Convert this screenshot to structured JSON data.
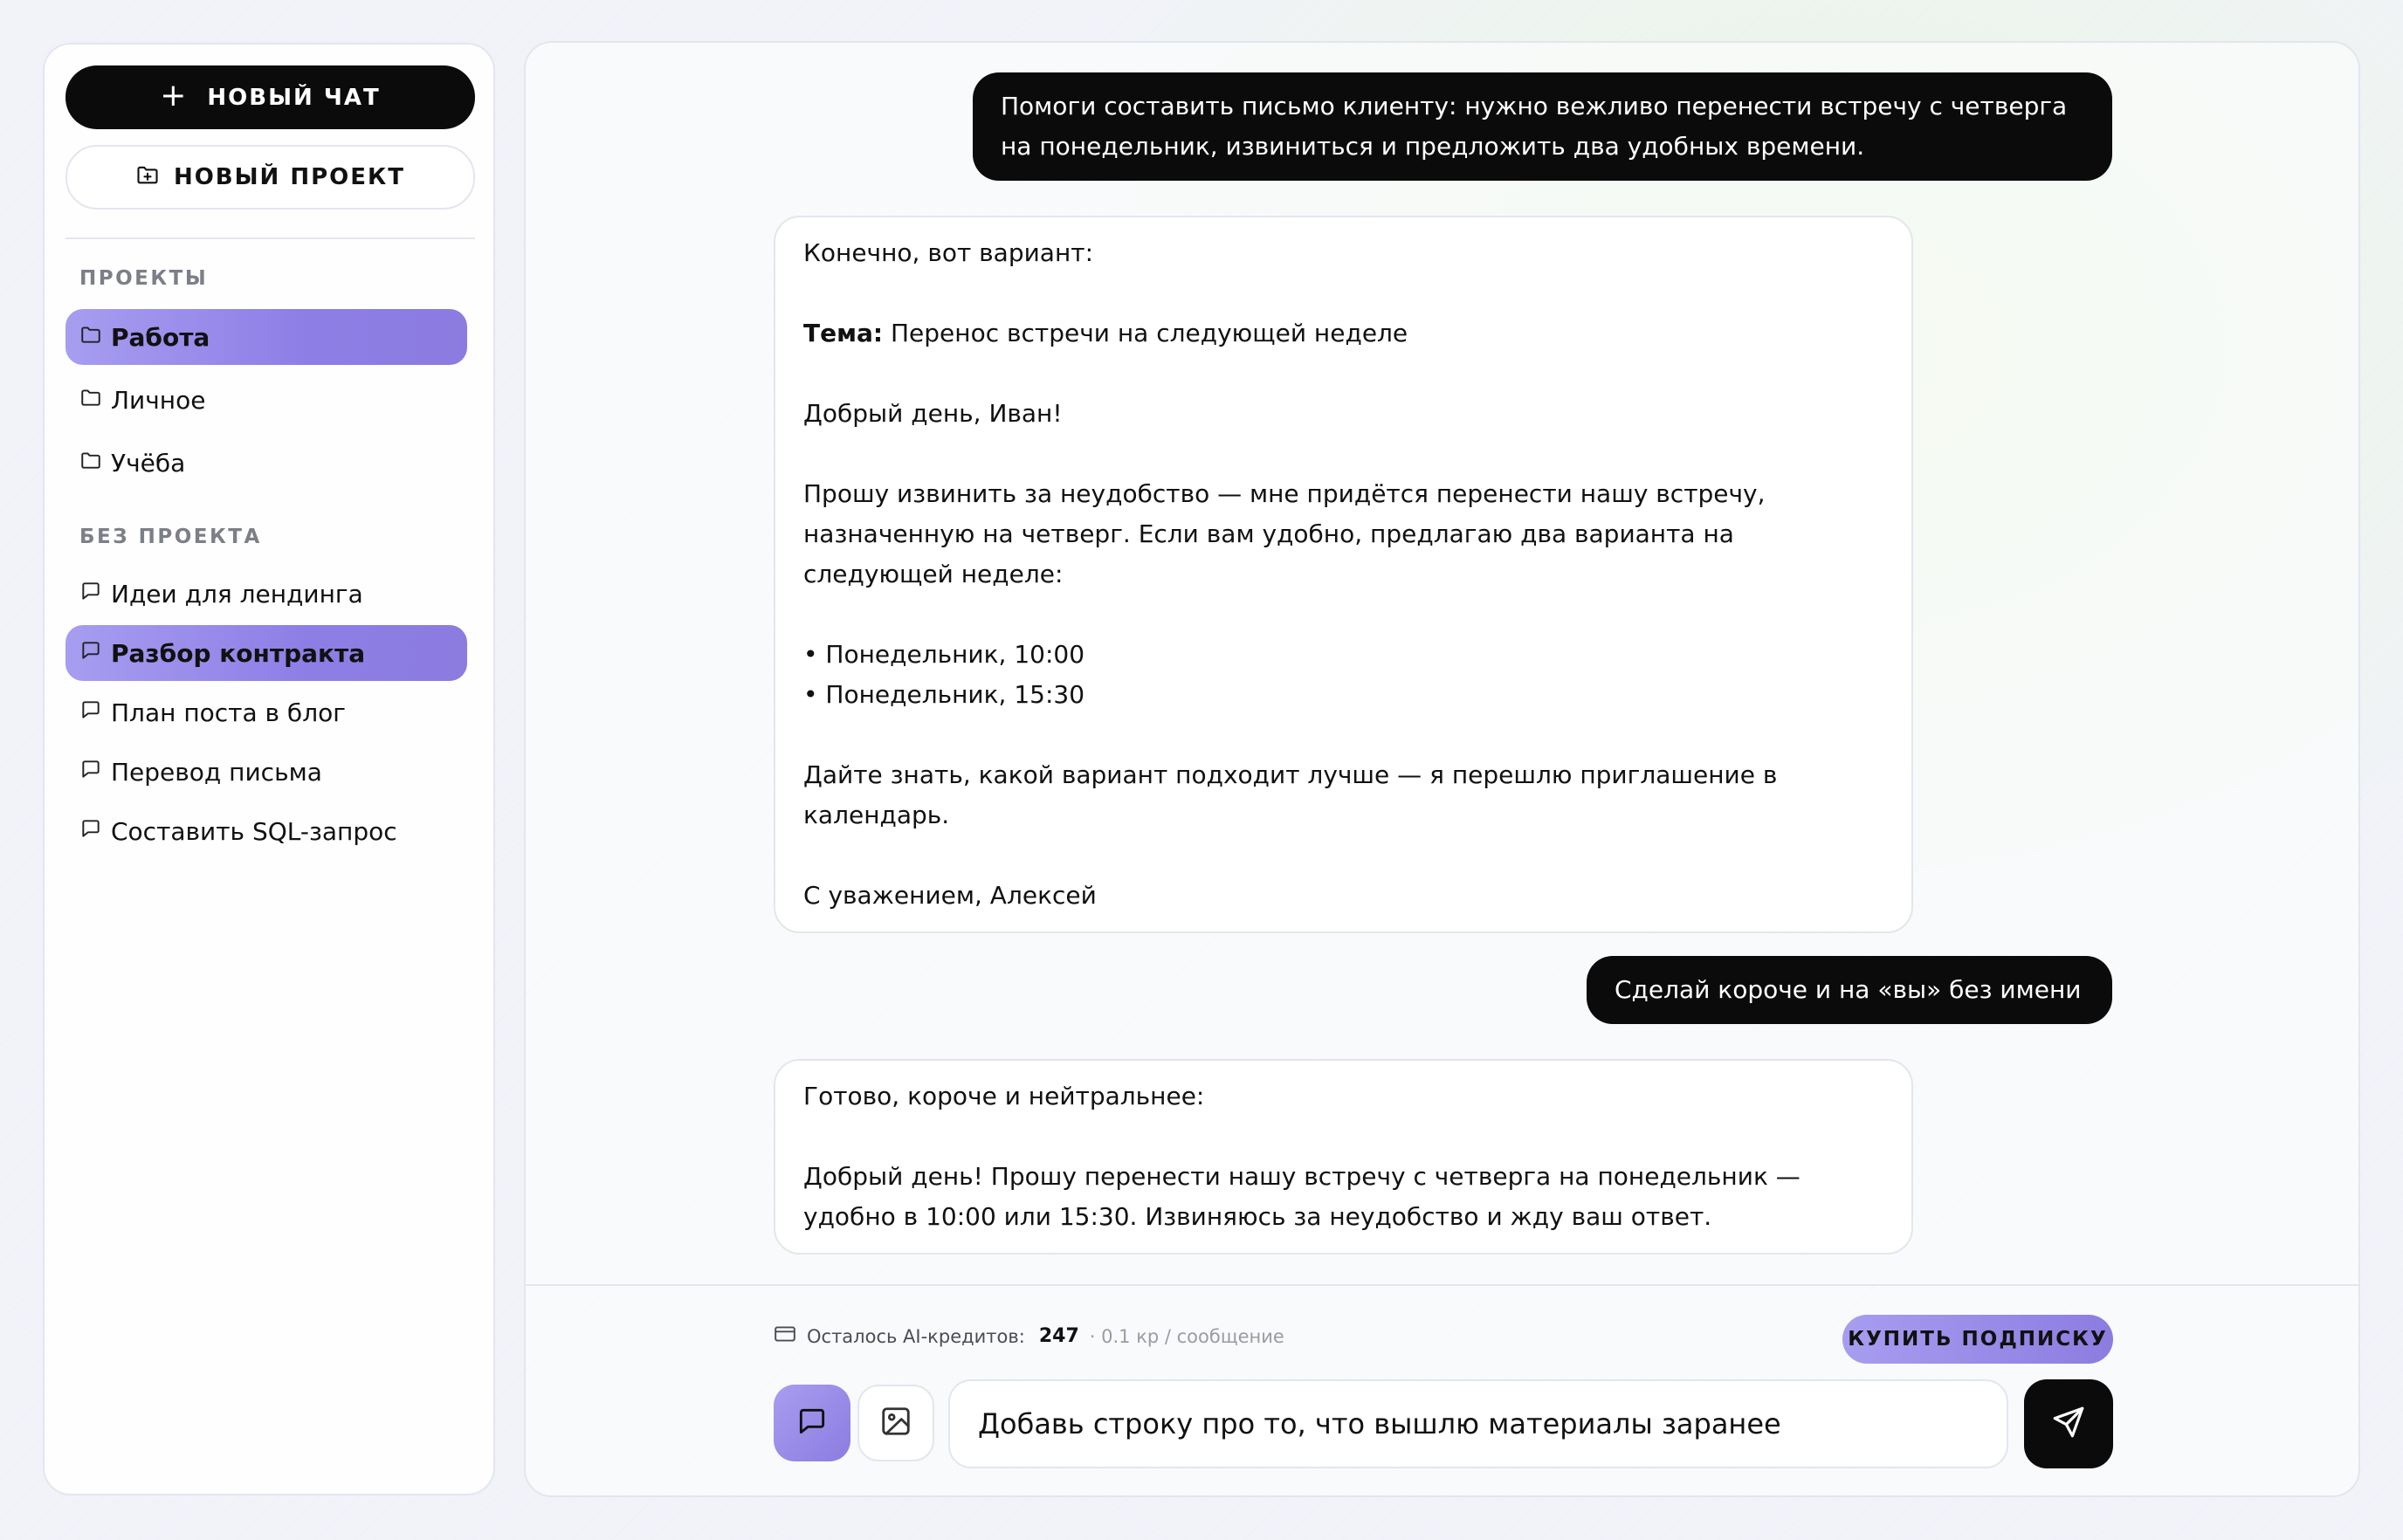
{
  "sidebar": {
    "new_chat_label": "НОВЫЙ ЧАТ",
    "new_chat_icon": "plus-icon",
    "new_project_label": "НОВЫЙ ПРОЕКТ",
    "new_project_icon": "folder-plus-icon",
    "projects_heading": "ПРОЕКТЫ",
    "projects": [
      {
        "label": "Работа",
        "icon": "folder-icon",
        "active": true
      },
      {
        "label": "Личное",
        "icon": "folder-icon",
        "active": false
      },
      {
        "label": "Учёба",
        "icon": "folder-icon",
        "active": false
      }
    ],
    "no_project_heading": "БЕЗ ПРОЕКТА",
    "chats": [
      {
        "label": "Идеи для лендинга",
        "icon": "chat-bubble-icon",
        "active": false
      },
      {
        "label": "Разбор контракта",
        "icon": "chat-bubble-icon",
        "active": true
      },
      {
        "label": "План поста в блог",
        "icon": "chat-bubble-icon",
        "active": false
      },
      {
        "label": "Перевод письма",
        "icon": "chat-bubble-icon",
        "active": false
      },
      {
        "label": "Составить SQL-запрос",
        "icon": "chat-bubble-icon",
        "active": false
      }
    ]
  },
  "messages": {
    "user1": {
      "line1": "Помоги составить письмо клиенту: нужно вежливо перенести встречу с четверга",
      "line2": "на понедельник, извиниться и предложить два удобных времени."
    },
    "ai1": {
      "intro": "Конечно, вот вариант:",
      "subject_label": "Тема:",
      "subject_text": " Перенос встречи на следующей неделе",
      "greeting": "Добрый день, Иван!",
      "body_line1": "Прошу извинить за неудобство — мне придётся перенести нашу встречу,",
      "body_line2": "назначенную на четверг. Если вам удобно, предлагаю два варианта на",
      "body_line3": "следующей неделе:",
      "option1": "• Понедельник, 10:00",
      "option2": "• Понедельник, 15:30",
      "closing_line1": "Дайте знать, какой вариант подходит лучше — я перешлю приглашение в",
      "closing_line2": "календарь.",
      "signature": "С уважением, Алексей"
    },
    "user2": {
      "text": "Сделай короче и на «вы» без имени"
    },
    "ai2": {
      "intro": "Готово, короче и нейтральнее:",
      "line1": "Добрый день! Прошу перенести нашу встречу с четверга на понедельник —",
      "line2": "удобно в 10:00 или 15:30. Извиняюсь за неудобство и жду ваш ответ."
    }
  },
  "composer": {
    "credits_label": "Осталось AI-кредитов:",
    "credits_count": "247",
    "credits_rate": "· 0.1 кр / сообщение",
    "credits_icon": "credit-card-icon",
    "subscribe_label": "КУПИТЬ ПОДПИСКУ",
    "mode_chat_icon": "chat-bubble-icon",
    "mode_image_icon": "image-icon",
    "input_value": "Добавь строку про то, что вышлю материалы заранее",
    "send_icon": "send-icon"
  },
  "colors": {
    "accent_start": "#a79df0",
    "accent_end": "#8c7ce0",
    "dark": "#0b0b0c",
    "border": "#e3e6ee",
    "muted": "#7c7f88"
  }
}
